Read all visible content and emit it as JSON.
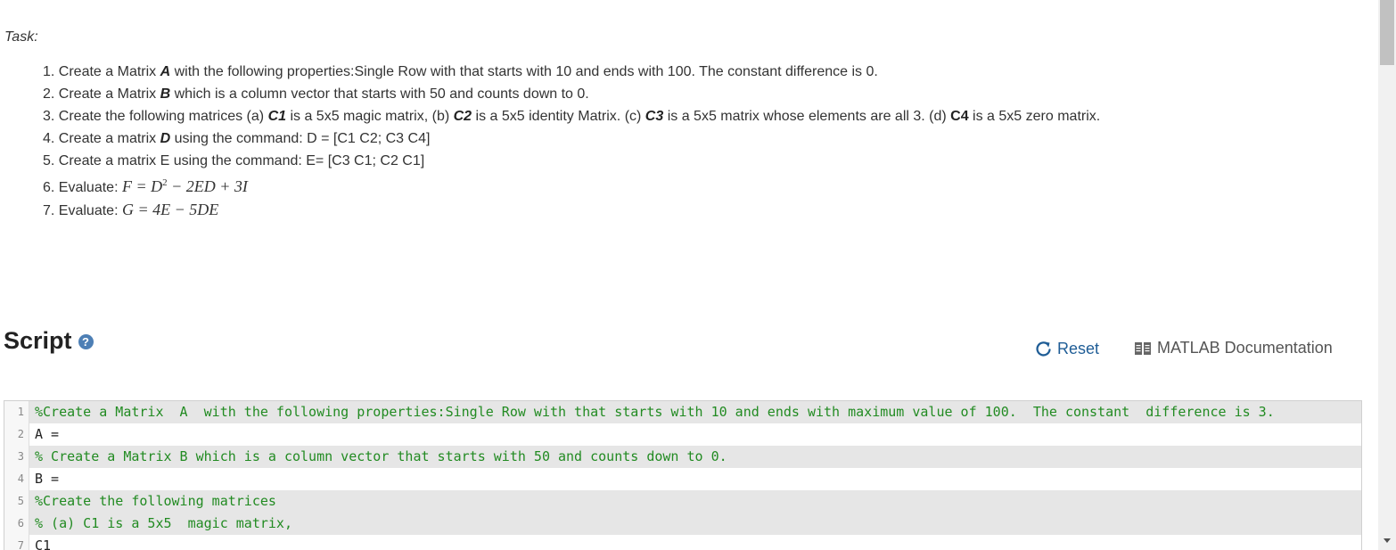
{
  "task": {
    "label": "Task:",
    "items": [
      {
        "num": "1.",
        "t1": "Create a Matrix ",
        "b1": "A",
        "t2": " with the following properties:Single Row with that starts with 10 and ends with 100.  The constant  difference is 0."
      },
      {
        "num": "2.",
        "t1": "Create a Matrix ",
        "b1": "B",
        "t2": " which is a column vector that starts with 50 and counts down to 0."
      },
      {
        "num": "3.",
        "t1": "Create the following matrices (a) ",
        "b1": "C1",
        "t2": " is a 5x5  magic matrix, (b) ",
        "b2": "C2",
        "t3": " is a 5x5 identity Matrix.  (c) ",
        "b3": "C3",
        "t4": " is a  5x5 matrix whose elements are all 3. (d) ",
        "b4": "C4",
        "t5": " is a 5x5 zero matrix."
      },
      {
        "num": "4.",
        "t1": "Create a matrix ",
        "b1": "D",
        "t2": " using the command:  D = [C1 C2; C3 C4]"
      },
      {
        "num": "5.",
        "t1": "Create a matrix E using the command:  E= [C3 C1; C2 C1]"
      },
      {
        "num": "6.",
        "t1": "Evaluate: ",
        "math_pre": "F = D",
        "math_sup": "2",
        "math_post": " − 2ED + 3I"
      },
      {
        "num": "7.",
        "t1": "Evaluate: ",
        "math": "G = 4E − 5DE"
      }
    ]
  },
  "script": {
    "title": "Script",
    "help_icon": "?",
    "reset_label": "Reset",
    "doc_label": "MATLAB Documentation"
  },
  "editor": {
    "lines": [
      {
        "n": "1",
        "text": "%Create a Matrix  A  with the following properties:Single Row with that starts with 10 and ends with maximum value of 100.  The constant  difference is 3."
      },
      {
        "n": "2",
        "text": "A ="
      },
      {
        "n": "3",
        "text": "% Create a Matrix B which is a column vector that starts with 50 and counts down to 0."
      },
      {
        "n": "4",
        "text": "B ="
      },
      {
        "n": "5",
        "text": "%Create the following matrices"
      },
      {
        "n": "6",
        "text": "% (a) C1 is a 5x5  magic matrix,"
      },
      {
        "n": "7",
        "text": "C1"
      }
    ]
  },
  "colors": {
    "comment": "#228b22",
    "link": "#1f5d96",
    "help": "#4d7fb5"
  }
}
